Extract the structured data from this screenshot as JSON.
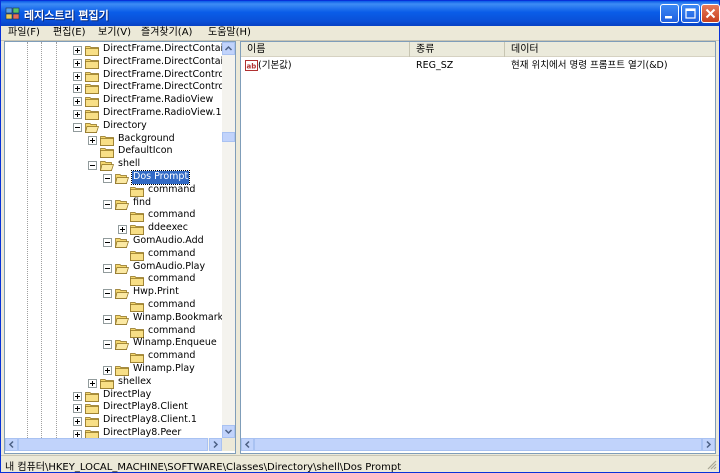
{
  "window": {
    "title": "레지스트리 편집기"
  },
  "menubar": [
    "파일(F)",
    "편집(E)",
    "보기(V)",
    "즐겨찾기(A)",
    "도움말(H)"
  ],
  "tree": {
    "rows": [
      {
        "label": "DirectFrame.DirectContaine",
        "level": 0,
        "expander": "plus",
        "open": false
      },
      {
        "label": "DirectFrame.DirectContaine",
        "level": 0,
        "expander": "plus",
        "open": false
      },
      {
        "label": "DirectFrame.DirectControl",
        "level": 0,
        "expander": "plus",
        "open": false
      },
      {
        "label": "DirectFrame.DirectControl.",
        "level": 0,
        "expander": "plus",
        "open": false
      },
      {
        "label": "DirectFrame.RadioView",
        "level": 0,
        "expander": "plus",
        "open": false
      },
      {
        "label": "DirectFrame.RadioView.1",
        "level": 0,
        "expander": "plus",
        "open": false
      },
      {
        "label": "Directory",
        "level": 0,
        "expander": "minus",
        "open": true
      },
      {
        "label": "Background",
        "level": 1,
        "expander": "plus",
        "open": false
      },
      {
        "label": "DefaultIcon",
        "level": 1,
        "expander": "none",
        "open": false
      },
      {
        "label": "shell",
        "level": 1,
        "expander": "minus",
        "open": true
      },
      {
        "label": "Dos Prompt",
        "level": 2,
        "expander": "minus",
        "open": true,
        "selected": true
      },
      {
        "label": "command",
        "level": 3,
        "expander": "none",
        "open": false
      },
      {
        "label": "find",
        "level": 2,
        "expander": "minus",
        "open": true
      },
      {
        "label": "command",
        "level": 3,
        "expander": "none",
        "open": false
      },
      {
        "label": "ddeexec",
        "level": 3,
        "expander": "plus",
        "open": false
      },
      {
        "label": "GomAudio.Add",
        "level": 2,
        "expander": "minus",
        "open": true
      },
      {
        "label": "command",
        "level": 3,
        "expander": "none",
        "open": false
      },
      {
        "label": "GomAudio.Play",
        "level": 2,
        "expander": "minus",
        "open": true
      },
      {
        "label": "command",
        "level": 3,
        "expander": "none",
        "open": false
      },
      {
        "label": "Hwp.Print",
        "level": 2,
        "expander": "minus",
        "open": true
      },
      {
        "label": "command",
        "level": 3,
        "expander": "none",
        "open": false
      },
      {
        "label": "Winamp.Bookmark",
        "level": 2,
        "expander": "minus",
        "open": true
      },
      {
        "label": "command",
        "level": 3,
        "expander": "none",
        "open": false
      },
      {
        "label": "Winamp.Enqueue",
        "level": 2,
        "expander": "minus",
        "open": true
      },
      {
        "label": "command",
        "level": 3,
        "expander": "none",
        "open": false
      },
      {
        "label": "Winamp.Play",
        "level": 2,
        "expander": "plus",
        "open": false
      },
      {
        "label": "shellex",
        "level": 1,
        "expander": "plus",
        "open": false
      },
      {
        "label": "DirectPlay",
        "level": 0,
        "expander": "plus",
        "open": false
      },
      {
        "label": "DirectPlay8.Client",
        "level": 0,
        "expander": "plus",
        "open": false
      },
      {
        "label": "DirectPlay8.Client.1",
        "level": 0,
        "expander": "plus",
        "open": false
      },
      {
        "label": "DirectPlay8.Peer",
        "level": 0,
        "expander": "plus",
        "open": false
      }
    ]
  },
  "list": {
    "columns": [
      "이름",
      "종류",
      "데이터"
    ],
    "rows": [
      {
        "name": "(기본값)",
        "type": "REG_SZ",
        "data": "현재 위치에서 명령 프롬프트 열기(&D)"
      }
    ]
  },
  "status": {
    "path": "내 컴퓨터\\HKEY_LOCAL_MACHINE\\SOFTWARE\\Classes\\Directory\\shell\\Dos Prompt"
  },
  "colors": {
    "titlebar": "#0a5de8",
    "selection": "#316ac5",
    "folder": "#f5d76e",
    "chrome": "#ece9d8"
  }
}
